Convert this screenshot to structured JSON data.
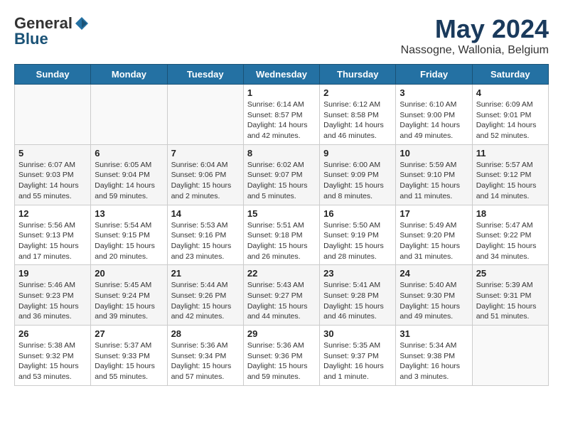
{
  "header": {
    "logo_general": "General",
    "logo_blue": "Blue",
    "month_title": "May 2024",
    "location": "Nassogne, Wallonia, Belgium"
  },
  "days_of_week": [
    "Sunday",
    "Monday",
    "Tuesday",
    "Wednesday",
    "Thursday",
    "Friday",
    "Saturday"
  ],
  "weeks": [
    [
      {
        "day": "",
        "info": ""
      },
      {
        "day": "",
        "info": ""
      },
      {
        "day": "",
        "info": ""
      },
      {
        "day": "1",
        "info": "Sunrise: 6:14 AM\nSunset: 8:57 PM\nDaylight: 14 hours\nand 42 minutes."
      },
      {
        "day": "2",
        "info": "Sunrise: 6:12 AM\nSunset: 8:58 PM\nDaylight: 14 hours\nand 46 minutes."
      },
      {
        "day": "3",
        "info": "Sunrise: 6:10 AM\nSunset: 9:00 PM\nDaylight: 14 hours\nand 49 minutes."
      },
      {
        "day": "4",
        "info": "Sunrise: 6:09 AM\nSunset: 9:01 PM\nDaylight: 14 hours\nand 52 minutes."
      }
    ],
    [
      {
        "day": "5",
        "info": "Sunrise: 6:07 AM\nSunset: 9:03 PM\nDaylight: 14 hours\nand 55 minutes."
      },
      {
        "day": "6",
        "info": "Sunrise: 6:05 AM\nSunset: 9:04 PM\nDaylight: 14 hours\nand 59 minutes."
      },
      {
        "day": "7",
        "info": "Sunrise: 6:04 AM\nSunset: 9:06 PM\nDaylight: 15 hours\nand 2 minutes."
      },
      {
        "day": "8",
        "info": "Sunrise: 6:02 AM\nSunset: 9:07 PM\nDaylight: 15 hours\nand 5 minutes."
      },
      {
        "day": "9",
        "info": "Sunrise: 6:00 AM\nSunset: 9:09 PM\nDaylight: 15 hours\nand 8 minutes."
      },
      {
        "day": "10",
        "info": "Sunrise: 5:59 AM\nSunset: 9:10 PM\nDaylight: 15 hours\nand 11 minutes."
      },
      {
        "day": "11",
        "info": "Sunrise: 5:57 AM\nSunset: 9:12 PM\nDaylight: 15 hours\nand 14 minutes."
      }
    ],
    [
      {
        "day": "12",
        "info": "Sunrise: 5:56 AM\nSunset: 9:13 PM\nDaylight: 15 hours\nand 17 minutes."
      },
      {
        "day": "13",
        "info": "Sunrise: 5:54 AM\nSunset: 9:15 PM\nDaylight: 15 hours\nand 20 minutes."
      },
      {
        "day": "14",
        "info": "Sunrise: 5:53 AM\nSunset: 9:16 PM\nDaylight: 15 hours\nand 23 minutes."
      },
      {
        "day": "15",
        "info": "Sunrise: 5:51 AM\nSunset: 9:18 PM\nDaylight: 15 hours\nand 26 minutes."
      },
      {
        "day": "16",
        "info": "Sunrise: 5:50 AM\nSunset: 9:19 PM\nDaylight: 15 hours\nand 28 minutes."
      },
      {
        "day": "17",
        "info": "Sunrise: 5:49 AM\nSunset: 9:20 PM\nDaylight: 15 hours\nand 31 minutes."
      },
      {
        "day": "18",
        "info": "Sunrise: 5:47 AM\nSunset: 9:22 PM\nDaylight: 15 hours\nand 34 minutes."
      }
    ],
    [
      {
        "day": "19",
        "info": "Sunrise: 5:46 AM\nSunset: 9:23 PM\nDaylight: 15 hours\nand 36 minutes."
      },
      {
        "day": "20",
        "info": "Sunrise: 5:45 AM\nSunset: 9:24 PM\nDaylight: 15 hours\nand 39 minutes."
      },
      {
        "day": "21",
        "info": "Sunrise: 5:44 AM\nSunset: 9:26 PM\nDaylight: 15 hours\nand 42 minutes."
      },
      {
        "day": "22",
        "info": "Sunrise: 5:43 AM\nSunset: 9:27 PM\nDaylight: 15 hours\nand 44 minutes."
      },
      {
        "day": "23",
        "info": "Sunrise: 5:41 AM\nSunset: 9:28 PM\nDaylight: 15 hours\nand 46 minutes."
      },
      {
        "day": "24",
        "info": "Sunrise: 5:40 AM\nSunset: 9:30 PM\nDaylight: 15 hours\nand 49 minutes."
      },
      {
        "day": "25",
        "info": "Sunrise: 5:39 AM\nSunset: 9:31 PM\nDaylight: 15 hours\nand 51 minutes."
      }
    ],
    [
      {
        "day": "26",
        "info": "Sunrise: 5:38 AM\nSunset: 9:32 PM\nDaylight: 15 hours\nand 53 minutes."
      },
      {
        "day": "27",
        "info": "Sunrise: 5:37 AM\nSunset: 9:33 PM\nDaylight: 15 hours\nand 55 minutes."
      },
      {
        "day": "28",
        "info": "Sunrise: 5:36 AM\nSunset: 9:34 PM\nDaylight: 15 hours\nand 57 minutes."
      },
      {
        "day": "29",
        "info": "Sunrise: 5:36 AM\nSunset: 9:36 PM\nDaylight: 15 hours\nand 59 minutes."
      },
      {
        "day": "30",
        "info": "Sunrise: 5:35 AM\nSunset: 9:37 PM\nDaylight: 16 hours\nand 1 minute."
      },
      {
        "day": "31",
        "info": "Sunrise: 5:34 AM\nSunset: 9:38 PM\nDaylight: 16 hours\nand 3 minutes."
      },
      {
        "day": "",
        "info": ""
      }
    ]
  ]
}
